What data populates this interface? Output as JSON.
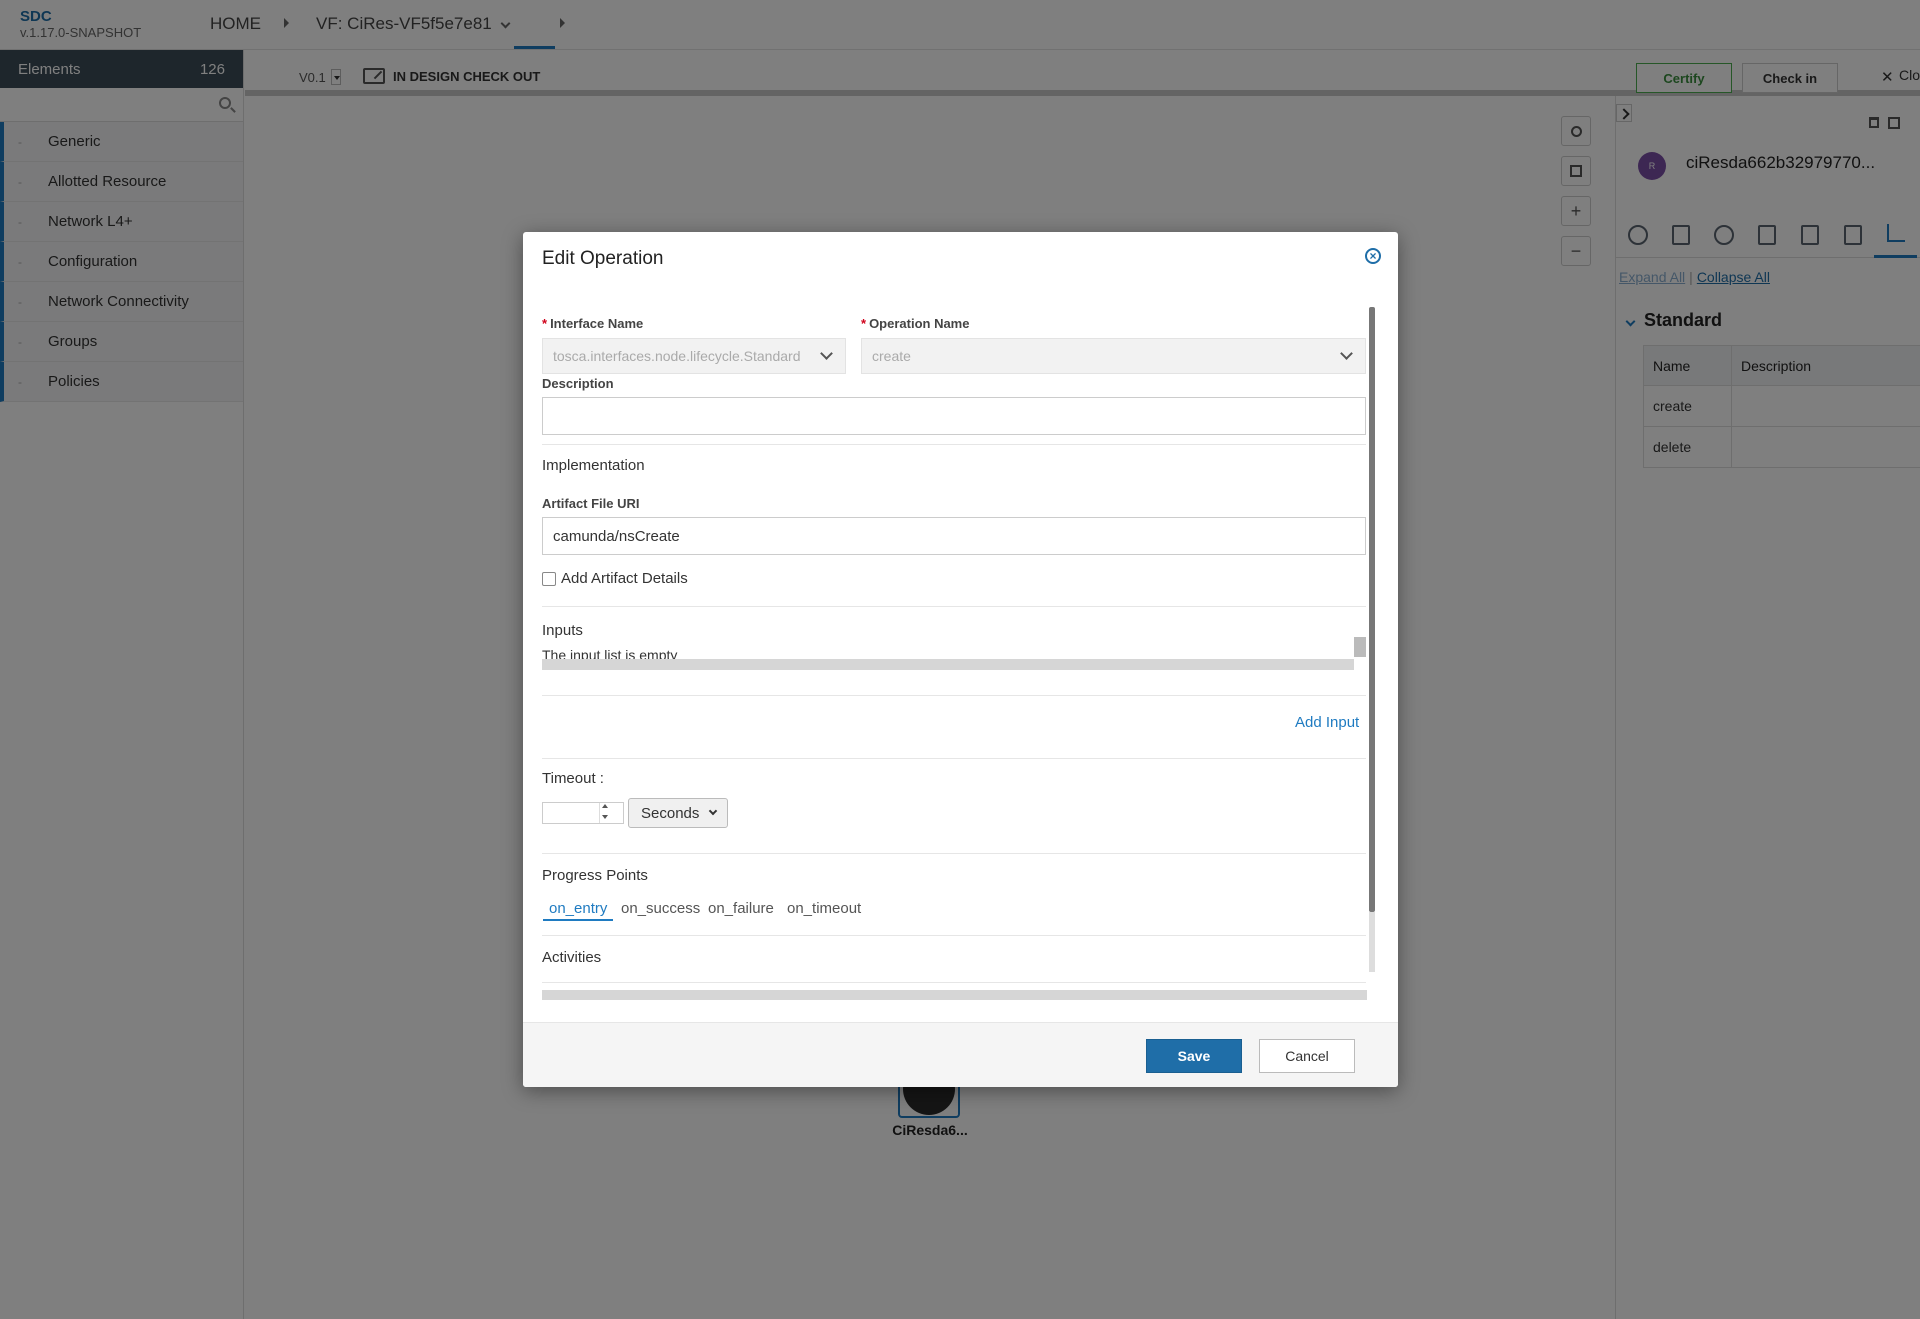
{
  "header": {
    "brand": "SDC",
    "version": "v.1.17.0-SNAPSHOT",
    "breadcrumbs": [
      {
        "label": "HOME"
      },
      {
        "label": "VF: CiRes-VF5f5e7e81"
      }
    ]
  },
  "palette": {
    "title": "Elements",
    "count": "126",
    "search_placeholder": "",
    "items": [
      {
        "label": "Generic"
      },
      {
        "label": "Allotted Resource"
      },
      {
        "label": "Network L4+"
      },
      {
        "label": "Configuration"
      },
      {
        "label": "Network Connectivity"
      },
      {
        "label": "Groups"
      },
      {
        "label": "Policies"
      }
    ]
  },
  "toolbar": {
    "version": "V0.1",
    "status": "IN DESIGN CHECK OUT",
    "certify_label": "Certify",
    "checkin_label": "Check in",
    "close_label": "Clo"
  },
  "canvas": {
    "node_label": "CiResda6..."
  },
  "right_panel": {
    "avatar_text": "R",
    "component_name": "ciResda662b32979770...",
    "expand_all": "Expand All",
    "collapse_all": "Collapse All",
    "section": "Standard",
    "columns": [
      "Name",
      "Description"
    ],
    "rows": [
      {
        "name": "create",
        "description": ""
      },
      {
        "name": "delete",
        "description": ""
      }
    ]
  },
  "modal": {
    "title": "Edit Operation",
    "interface_name_label": "Interface Name",
    "interface_name_value": "tosca.interfaces.node.lifecycle.Standard",
    "operation_name_label": "Operation Name",
    "operation_name_value": "create",
    "description_label": "Description",
    "description_value": "",
    "implementation_title": "Implementation",
    "artifact_uri_label": "Artifact File URI",
    "artifact_uri_value": "camunda/nsCreate",
    "add_artifact_details": "Add Artifact Details",
    "inputs_title": "Inputs",
    "inputs_empty": "The input list is empty",
    "add_input": "Add Input",
    "timeout_label": "Timeout :",
    "timeout_value": "",
    "timeout_unit": "Seconds",
    "progress_title": "Progress Points",
    "progress_tabs": [
      "on_entry",
      "on_success",
      "on_failure",
      "on_timeout"
    ],
    "activities_title": "Activities",
    "save_label": "Save",
    "cancel_label": "Cancel"
  }
}
